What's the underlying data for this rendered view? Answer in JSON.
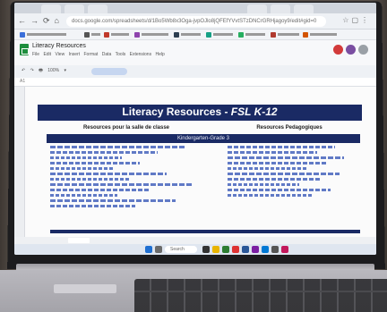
{
  "browser": {
    "url": "docs.google.com/spreadsheets/d/1Bo5Wb8x3Oga-jvpOJlo8jQFEfYVvtSTzDNCrGRHjagoy9/edit#gid=0"
  },
  "sheets": {
    "doc_title": "Literacy Resources",
    "menus": "File Edit View Insert Format Data Tools Extensions Help",
    "cell_ref": "A1"
  },
  "sheet": {
    "title_main": "Literacy Resources - ",
    "title_emph": "FSL K-12",
    "col_left_header": "Resources pour la salle de classe",
    "col_right_header": "Resources Pedagogiques",
    "band_label": "Kindergarten-Grade 3"
  },
  "taskbar": {
    "search_label": "Search"
  },
  "colors": {
    "title_band": "#1a2a64",
    "link_blue": "#1f3f9a"
  }
}
